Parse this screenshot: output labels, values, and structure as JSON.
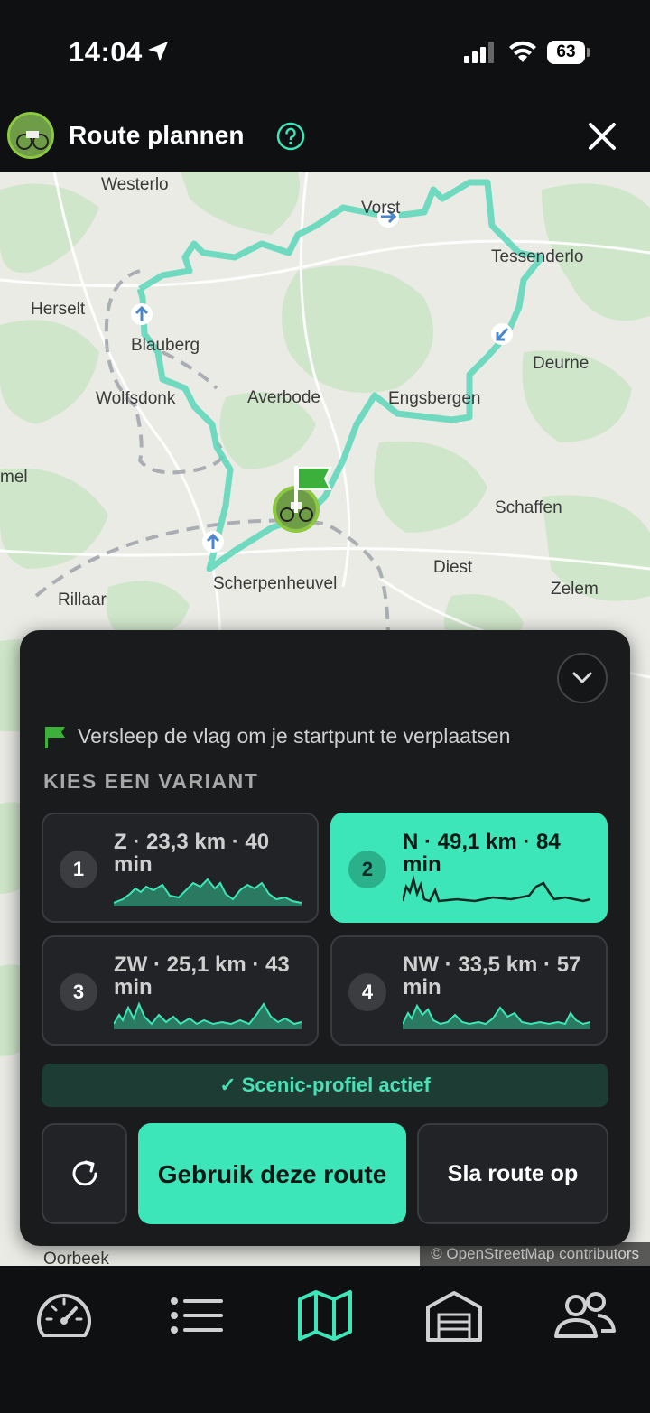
{
  "status_bar": {
    "time": "14:04",
    "battery": "63"
  },
  "header": {
    "title": "Route plannen"
  },
  "map": {
    "labels": [
      "Westerlo",
      "Vorst",
      "Tessenderlo",
      "Herselt",
      "Blauberg",
      "Deurne",
      "Wolfsdonk",
      "Averbode",
      "Engsbergen",
      "mel",
      "Schaffen",
      "Diest",
      "Scherpenheuvel",
      "Rillaar",
      "Zelem",
      "Oorbeek"
    ],
    "attribution": "© OpenStreetMap contributors"
  },
  "panel": {
    "hint": "Versleep de vlag om je startpunt te verplaatsen",
    "section_title": "KIES EEN VARIANT",
    "variants": [
      {
        "number": "1",
        "label": "Z · 23,3 km · 40 min"
      },
      {
        "number": "2",
        "label": "N · 49,1 km · 84 min",
        "selected": true
      },
      {
        "number": "3",
        "label": "ZW · 25,1 km · 43 min"
      },
      {
        "number": "4",
        "label": "NW · 33,5 km · 57 min"
      }
    ],
    "scenic": "✓ Scenic-profiel actief",
    "use_button": "Gebruik deze route",
    "save_button": "Sla route op"
  },
  "colors": {
    "accent": "#3de6b8",
    "route": "#5ad7b8",
    "panel": "#1a1b1d"
  },
  "tabbar": {
    "items": [
      "dashboard-icon",
      "list-icon",
      "map-icon",
      "garage-icon",
      "people-icon"
    ],
    "active": "map-icon"
  }
}
